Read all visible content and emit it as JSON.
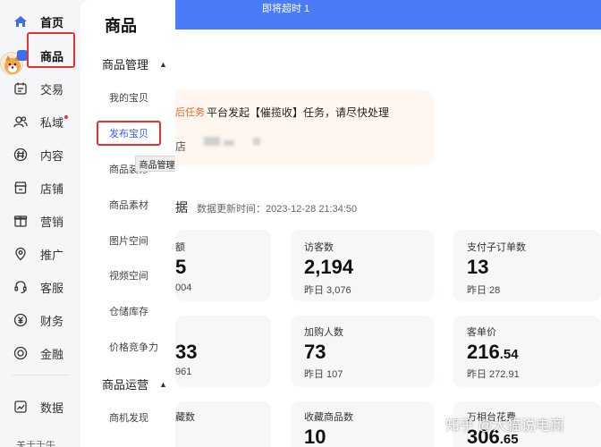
{
  "leftnav": {
    "items": [
      {
        "label": "首页",
        "icon": "home-icon"
      },
      {
        "label": "商品",
        "icon": "goods-icon"
      },
      {
        "label": "交易",
        "icon": "trade-icon"
      },
      {
        "label": "私域",
        "icon": "private-domain-icon"
      },
      {
        "label": "内容",
        "icon": "content-icon"
      },
      {
        "label": "店铺",
        "icon": "store-icon"
      },
      {
        "label": "营销",
        "icon": "marketing-icon"
      },
      {
        "label": "推广",
        "icon": "promotion-icon"
      },
      {
        "label": "客服",
        "icon": "customer-service-icon"
      },
      {
        "label": "财务",
        "icon": "finance-icon"
      },
      {
        "label": "金融",
        "icon": "loan-icon"
      },
      {
        "label": "数据",
        "icon": "data-icon"
      }
    ],
    "bottom_partial": "关于千牛"
  },
  "submenu": {
    "title": "商品",
    "group1": "商品管理",
    "items1": [
      "我的宝贝",
      "发布宝贝",
      "商品装修",
      "商品素材",
      "图片空间",
      "视频空间",
      "仓储库存",
      "价格竞争力"
    ],
    "group2": "商品运营",
    "items2": [
      "商机发现"
    ],
    "tooltip": "商品管理"
  },
  "topbar": {
    "text": "即将超时 1"
  },
  "notice": {
    "tag": "后任务",
    "text": "平台发起【催揽收】任务，请尽快处理",
    "sub": "店"
  },
  "section": {
    "title": "据",
    "update_time": "数据更新时间：2023-12-28 21:34:50"
  },
  "cards": [
    {
      "label": "额",
      "value": "5",
      "yesterday": "004"
    },
    {
      "label": "访客数",
      "value": "2,194",
      "yesterday": "昨日 3,076"
    },
    {
      "label": "支付子订单数",
      "value": "13",
      "yesterday": "昨日 28"
    },
    {
      "label": "",
      "value": "33",
      "yesterday": "961"
    },
    {
      "label": "加购人数",
      "value": "73",
      "yesterday": "昨日 107"
    },
    {
      "label": "客单价",
      "value_int": "216",
      "value_dec": ".54",
      "yesterday": "昨日 272.91"
    },
    {
      "label": "藏数",
      "value": ""
    },
    {
      "label": "收藏商品数",
      "value": "10"
    },
    {
      "label": "万相台花费",
      "value_int": "306",
      "value_dec": ".65"
    }
  ],
  "watermark": "知乎 @大猫说电商",
  "colors": {
    "primary": "#4a7cf7",
    "highlight_box": "#e5322d",
    "warning": "#e9662d",
    "active_link": "#3b5cf6"
  }
}
